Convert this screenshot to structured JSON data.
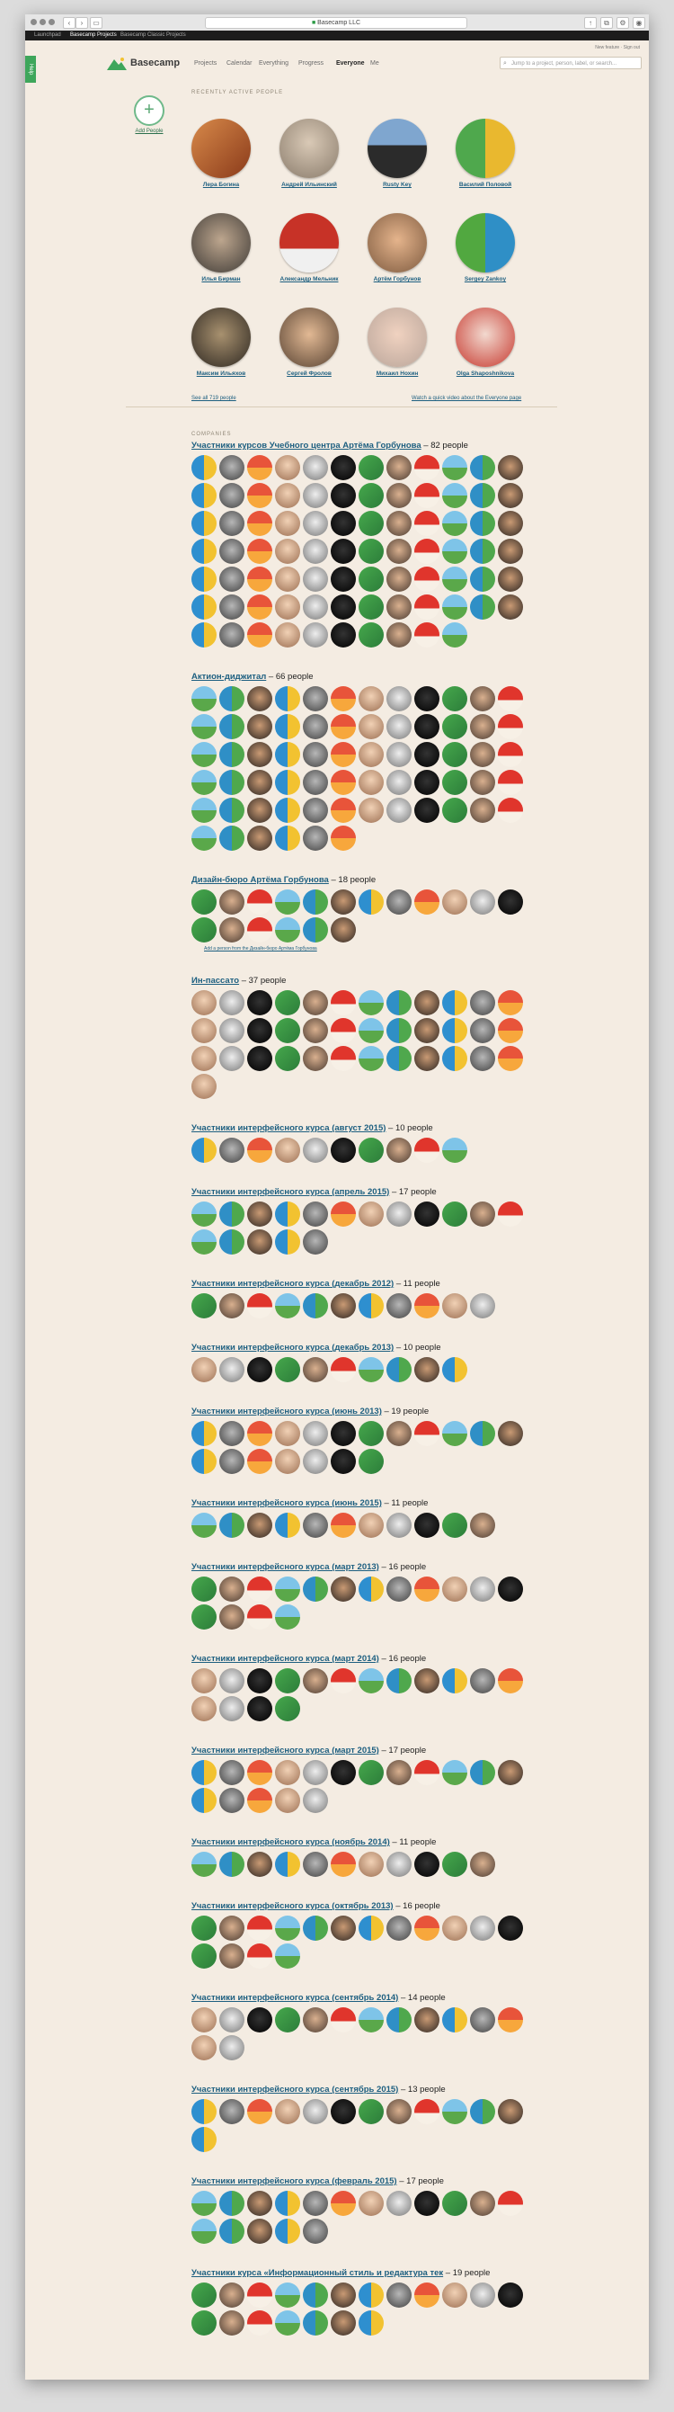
{
  "browser": {
    "url": "Basecamp LLC",
    "tabs": [
      "Launchpad",
      "Basecamp Projects",
      "Basecamp Classic Projects"
    ]
  },
  "help_tab": "Help",
  "toplinks": "New feature · Sign out",
  "nav": {
    "brand": "Basecamp",
    "items": [
      "Projects",
      "Calendar",
      "Everything",
      "Progress",
      "Everyone",
      "Me"
    ],
    "active": "Everyone",
    "search_placeholder": "Jump to a project, person, label, or search..."
  },
  "add_people": "Add People",
  "recent_label": "RECENTLY ACTIVE PEOPLE",
  "recent": [
    {
      "name": "Лера Боrина"
    },
    {
      "name": "Андрей Ильинский"
    },
    {
      "name": "Rusty Key"
    },
    {
      "name": "Василий Половой"
    },
    {
      "name": "Илья Бирман"
    },
    {
      "name": "Александр Мельник"
    },
    {
      "name": "Артём Горбунов"
    },
    {
      "name": "Sergey Zankoy"
    },
    {
      "name": "Максим Ильяхов"
    },
    {
      "name": "Сергей Фролов"
    },
    {
      "name": "Михаил Нохин"
    },
    {
      "name": "Olga Shaposhnikova"
    }
  ],
  "see_all": "See all 719 people",
  "video_link": "Watch a quick video about the Everyone page",
  "companies_label": "COMPANIES",
  "companies": [
    {
      "name": "Участники курсов Учебного центра Артёма Горбунова",
      "count": " – 82 people",
      "n": 82
    },
    {
      "name": "Актион-диджитал",
      "count": " – 66 people",
      "n": 66
    },
    {
      "name": "Дизайн-бюро Артёма Горбунова",
      "count": " – 18 people",
      "n": 18,
      "add_link": "Add a person from the Дизайн-бюро Артёма Горбунова"
    },
    {
      "name": "Ин-пассато",
      "count": " – 37 people",
      "n": 37
    },
    {
      "name": "Участники интерфейсного курса (август 2015)",
      "count": " – 10 people",
      "n": 10
    },
    {
      "name": "Участники интерфейсного курса (апрель 2015)",
      "count": " – 17 people",
      "n": 17
    },
    {
      "name": "Участники интерфейсного курса (декабрь 2012)",
      "count": " – 11 people",
      "n": 11
    },
    {
      "name": "Участники интерфейсного курса (декабрь 2013)",
      "count": " – 10 people",
      "n": 10
    },
    {
      "name": "Участники интерфейсного курса (июнь 2013)",
      "count": " – 19 people",
      "n": 19
    },
    {
      "name": "Участники интерфейсного курса (июнь 2015)",
      "count": " – 11 people",
      "n": 11
    },
    {
      "name": "Участники интерфейсного курса (март 2013)",
      "count": " – 16 people",
      "n": 16
    },
    {
      "name": "Участники интерфейсного курса (март 2014)",
      "count": " – 16 people",
      "n": 16
    },
    {
      "name": "Участники интерфейсного курса (март 2015)",
      "count": " – 17 people",
      "n": 17
    },
    {
      "name": "Участники интерфейсного курса (ноябрь 2014)",
      "count": " – 11 people",
      "n": 11
    },
    {
      "name": "Участники интерфейсного курса (октябрь 2013)",
      "count": " – 16 people",
      "n": 16
    },
    {
      "name": "Участники интерфейсного курса (сентябрь 2014)",
      "count": " – 14 people",
      "n": 14
    },
    {
      "name": "Участники интерфейсного курса (сентябрь 2015)",
      "count": " – 13 people",
      "n": 13
    },
    {
      "name": "Участники интерфейсного курса (февраль 2015)",
      "count": " – 17 people",
      "n": 17
    },
    {
      "name": "Участники курса «Информационный стиль и редактура тек",
      "count": " – 19 people",
      "n": 19
    }
  ],
  "colors": {
    "accent": "#3ea65b",
    "link": "#1d5f80",
    "background": "#f4ece2"
  }
}
